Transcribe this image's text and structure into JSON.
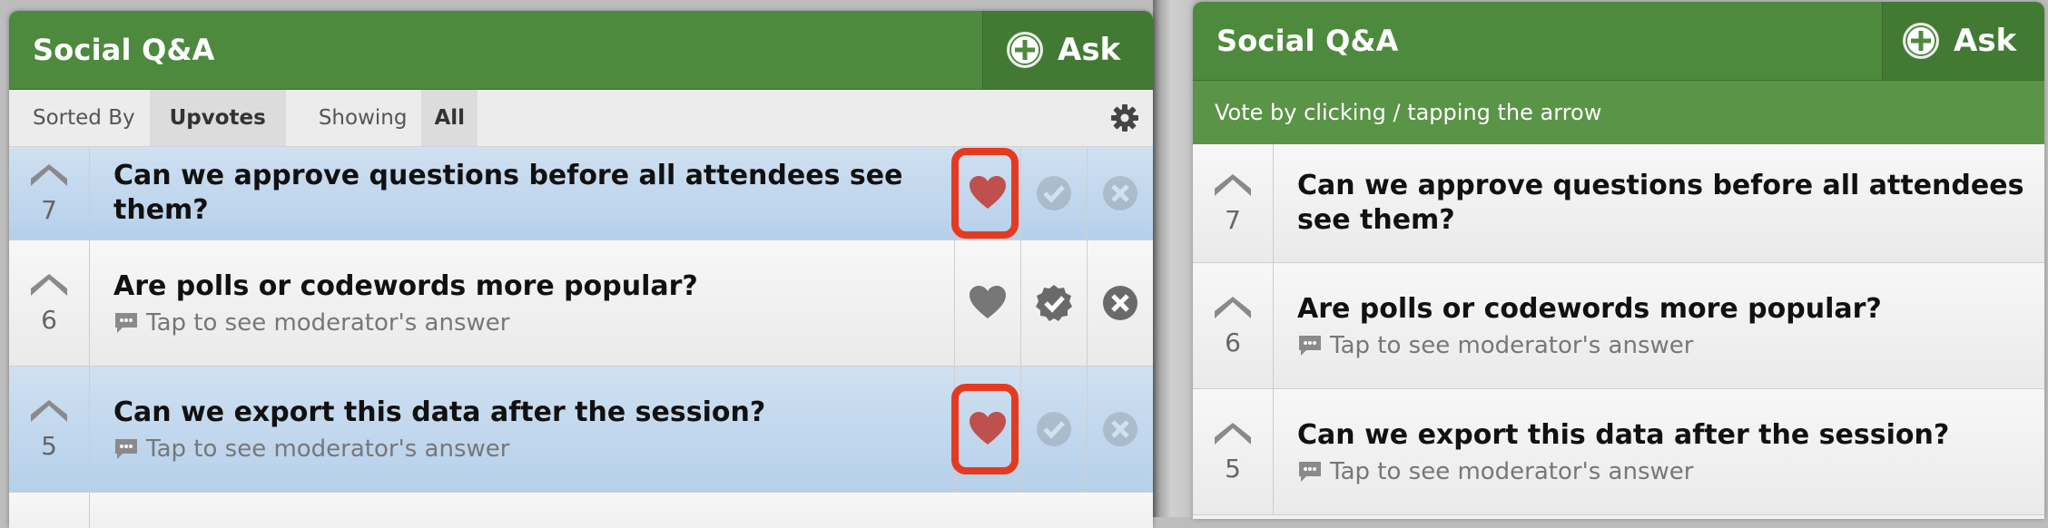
{
  "colors": {
    "header_green": "#4e8a3e",
    "highlight_blue": "#c4d9ee",
    "heart_red": "#c0504d",
    "annotation_red": "#e53a22"
  },
  "left_panel": {
    "title": "Social Q&A",
    "ask_label": "Ask",
    "sorted_by_label": "Sorted By",
    "sorted_by_value": "Upvotes",
    "showing_label": "Showing",
    "showing_value": "All",
    "questions": [
      {
        "votes": "7",
        "text": "Can we approve questions before all attendees see them?",
        "answer_hint": "",
        "highlighted": true,
        "liked": true
      },
      {
        "votes": "6",
        "text": "Are polls or codewords more popular?",
        "answer_hint": "Tap to see moderator's answer",
        "highlighted": false,
        "liked": false
      },
      {
        "votes": "5",
        "text": "Can we export this data after the session?",
        "answer_hint": "Tap to see moderator's answer",
        "highlighted": true,
        "liked": true
      }
    ]
  },
  "right_panel": {
    "title": "Social Q&A",
    "ask_label": "Ask",
    "instruction": "Vote by clicking / tapping the arrow",
    "questions": [
      {
        "votes": "7",
        "text": "Can we approve questions before all attendees see them?"
      },
      {
        "votes": "6",
        "text": "Are polls or codewords more popular?",
        "answer_hint": "Tap to see moderator's answer"
      },
      {
        "votes": "5",
        "text": "Can we export this data after the session?",
        "answer_hint": "Tap to see moderator's answer"
      }
    ]
  }
}
